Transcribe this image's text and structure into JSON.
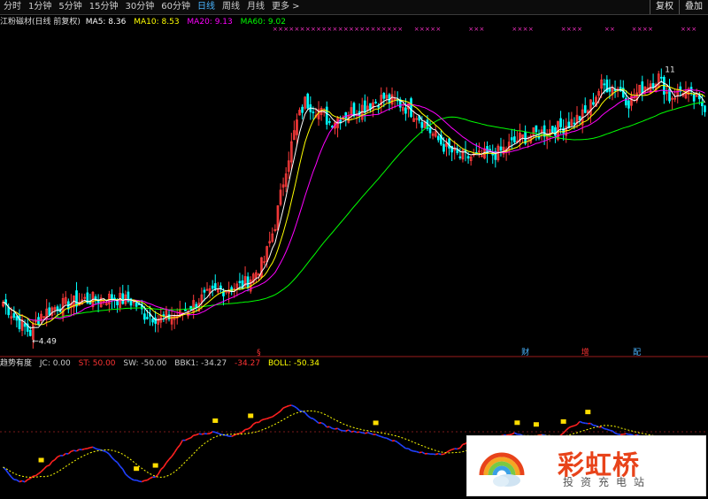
{
  "toolbar": {
    "periods": [
      "分时",
      "1分钟",
      "5分钟",
      "15分钟",
      "30分钟",
      "60分钟",
      "日线",
      "周线",
      "月线",
      "更多 >"
    ],
    "active_period": "日线",
    "right_buttons": [
      "复权",
      "叠加"
    ]
  },
  "main_panel": {
    "stock_label": "江粉磁材(日线 前复权)",
    "ma_legend": [
      {
        "label": "MA5: 8.36",
        "color": "#ffffff"
      },
      {
        "label": "MA10: 8.53",
        "color": "#ffff00"
      },
      {
        "label": "MA20: 9.13",
        "color": "#ff00ff"
      },
      {
        "label": "MA60: 9.02",
        "color": "#00ff00"
      }
    ],
    "low_marker": "4.49",
    "high_marker": "11",
    "event_markers": [
      {
        "label": "§",
        "color": "#ff3333",
        "index": 94
      },
      {
        "label": "财",
        "color": "#4ab4ff",
        "index": 192
      },
      {
        "label": "增",
        "color": "#ff3333",
        "index": 214
      },
      {
        "label": "配",
        "color": "#4ab4ff",
        "index": 233
      }
    ]
  },
  "indicator_panel": {
    "name": "趋势有度",
    "legend": [
      {
        "label": "JC: 0.00",
        "color": "#cccccc"
      },
      {
        "label": "ST: 50.00",
        "color": "#ff3333"
      },
      {
        "label": "SW: -50.00",
        "color": "#cccccc"
      },
      {
        "label": "BBK1: -34.27",
        "color": "#cccccc"
      },
      {
        "label": "-34.27",
        "color": "#ff3333"
      },
      {
        "label": "BOLL: -50.34",
        "color": "#ffff00"
      }
    ]
  },
  "watermark": {
    "name": "彩虹桥",
    "subtitle": "投资充电站"
  },
  "chart_data": {
    "type": "candlestick",
    "price_range": [
      4.2,
      12.0
    ],
    "indicator_range": [
      -100,
      100
    ],
    "ma_colors": {
      "ma5": "#ffffff",
      "ma10": "#ffff00",
      "ma20": "#ff00ff",
      "ma60": "#00ff00"
    },
    "candle_colors": {
      "up": "#ff3b3b",
      "down": "#00ffff"
    },
    "indicator_colors": {
      "rising": "#ff2020",
      "falling": "#2040ff",
      "signal": "#ffff00"
    },
    "anchors": [
      [
        0,
        5.3
      ],
      [
        5,
        4.85
      ],
      [
        10,
        4.55
      ],
      [
        14,
        5.0
      ],
      [
        20,
        5.2
      ],
      [
        30,
        5.35
      ],
      [
        40,
        5.4
      ],
      [
        48,
        5.3
      ],
      [
        52,
        5.0
      ],
      [
        58,
        4.9
      ],
      [
        65,
        5.0
      ],
      [
        72,
        5.35
      ],
      [
        80,
        5.6
      ],
      [
        88,
        5.7
      ],
      [
        92,
        5.95
      ],
      [
        96,
        6.3
      ],
      [
        100,
        7.2
      ],
      [
        104,
        8.6
      ],
      [
        108,
        9.7
      ],
      [
        111,
        10.2
      ],
      [
        116,
        10.0
      ],
      [
        120,
        9.7
      ],
      [
        126,
        9.9
      ],
      [
        133,
        10.1
      ],
      [
        140,
        10.3
      ],
      [
        146,
        10.15
      ],
      [
        152,
        9.9
      ],
      [
        158,
        9.4
      ],
      [
        163,
        9.05
      ],
      [
        168,
        8.85
      ],
      [
        175,
        8.85
      ],
      [
        182,
        8.95
      ],
      [
        190,
        9.3
      ],
      [
        198,
        9.45
      ],
      [
        206,
        9.6
      ],
      [
        214,
        9.9
      ],
      [
        220,
        10.6
      ],
      [
        226,
        10.55
      ],
      [
        230,
        10.2
      ],
      [
        236,
        10.6
      ],
      [
        241,
        10.8
      ],
      [
        245,
        10.3
      ],
      [
        250,
        10.5
      ],
      [
        255,
        10.2
      ],
      [
        258,
        10.1
      ]
    ],
    "candle_count": 259,
    "lowest_close": 4.49,
    "indicator_st": [
      [
        0,
        -55
      ],
      [
        4,
        -75
      ],
      [
        8,
        -78
      ],
      [
        14,
        -62
      ],
      [
        20,
        -38
      ],
      [
        26,
        -28
      ],
      [
        32,
        -22
      ],
      [
        38,
        -30
      ],
      [
        42,
        -48
      ],
      [
        46,
        -70
      ],
      [
        50,
        -78
      ],
      [
        56,
        -70
      ],
      [
        60,
        -48
      ],
      [
        66,
        -12
      ],
      [
        72,
        0
      ],
      [
        78,
        2
      ],
      [
        84,
        -5
      ],
      [
        88,
        3
      ],
      [
        92,
        14
      ],
      [
        96,
        24
      ],
      [
        99,
        28
      ],
      [
        103,
        40
      ],
      [
        106,
        45
      ],
      [
        110,
        36
      ],
      [
        115,
        20
      ],
      [
        120,
        10
      ],
      [
        126,
        5
      ],
      [
        132,
        2
      ],
      [
        138,
        -3
      ],
      [
        144,
        -12
      ],
      [
        150,
        -28
      ],
      [
        156,
        -33
      ],
      [
        162,
        -32
      ],
      [
        168,
        -22
      ],
      [
        172,
        -10
      ],
      [
        176,
        -6
      ],
      [
        182,
        -4
      ],
      [
        188,
        0
      ],
      [
        194,
        -6
      ],
      [
        198,
        -2
      ],
      [
        204,
        -6
      ],
      [
        208,
        8
      ],
      [
        212,
        18
      ],
      [
        216,
        16
      ],
      [
        220,
        10
      ],
      [
        226,
        0
      ],
      [
        232,
        -3
      ],
      [
        240,
        -8
      ],
      [
        248,
        -5
      ],
      [
        258,
        -15
      ]
    ],
    "signal_markers": [
      14,
      49,
      56,
      78,
      91,
      137,
      189,
      196,
      206,
      215
    ],
    "pink_x_ranges": [
      [
        100,
        116
      ],
      [
        118,
        134
      ],
      [
        136,
        146
      ],
      [
        152,
        160
      ],
      [
        172,
        176
      ],
      [
        188,
        194
      ],
      [
        206,
        212
      ],
      [
        222,
        225
      ],
      [
        232,
        239
      ],
      [
        250,
        255
      ]
    ]
  }
}
